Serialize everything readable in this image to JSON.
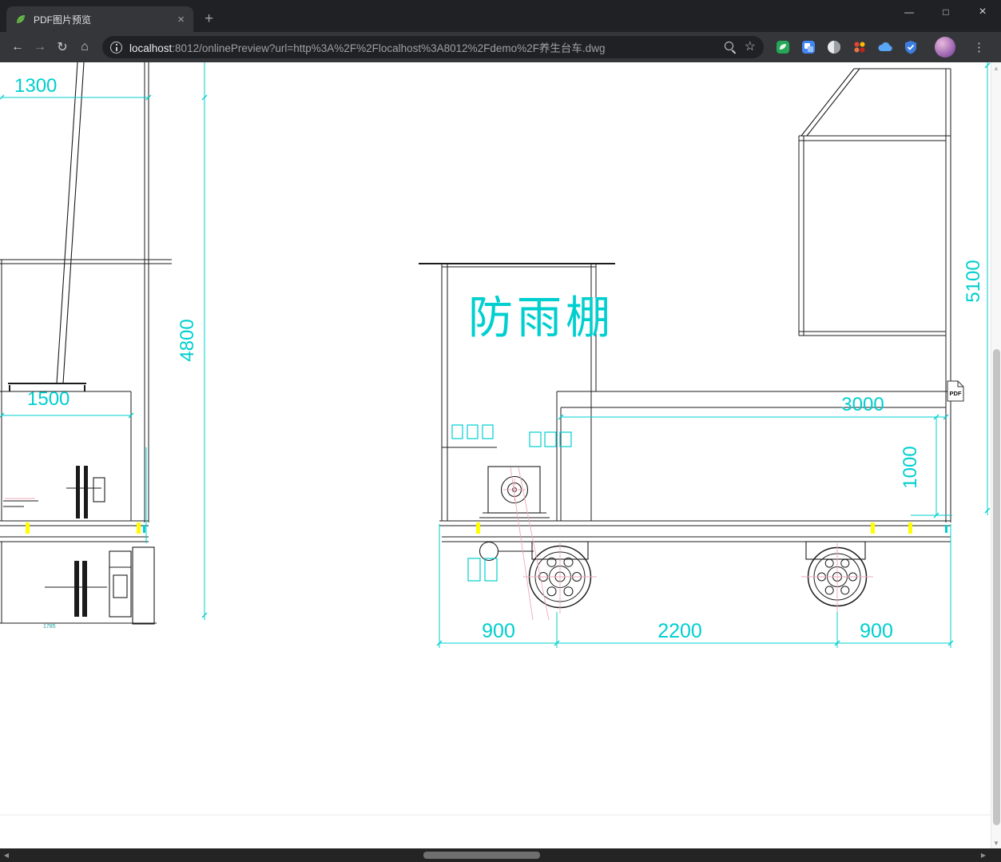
{
  "browser": {
    "tab_title": "PDF图片预览",
    "url_host": "localhost",
    "url_rest": ":8012/onlinePreview?url=http%3A%2F%2Flocalhost%3A8012%2Fdemo%2F养生台车.dwg",
    "icons": {
      "tab_close": "×",
      "new_tab": "+",
      "minimize": "—",
      "maximize": "□",
      "close": "×",
      "back": "←",
      "forward": "→",
      "reload": "↻",
      "home": "⌂",
      "bookmark_star": "☆",
      "menu_kebab": "⋮"
    }
  },
  "scrollbar": {
    "up": "▲",
    "down": "▼",
    "left": "◀",
    "right": "▶"
  },
  "drawing": {
    "shelter_label": "防雨棚",
    "pdf_badge": "PDF",
    "dims": {
      "d1300": "1300",
      "d4800": "4800",
      "d1500": "1500",
      "d5100": "5100",
      "d3000": "3000",
      "d1000": "1000",
      "d900_left": "900",
      "d2200": "2200",
      "d900_right": "900",
      "d_small": "1785"
    },
    "colors": {
      "dimension": "#00cfcf",
      "highlight": "#ffff00",
      "centerline": "#ecaab8",
      "line": "#1b1b1b"
    }
  }
}
